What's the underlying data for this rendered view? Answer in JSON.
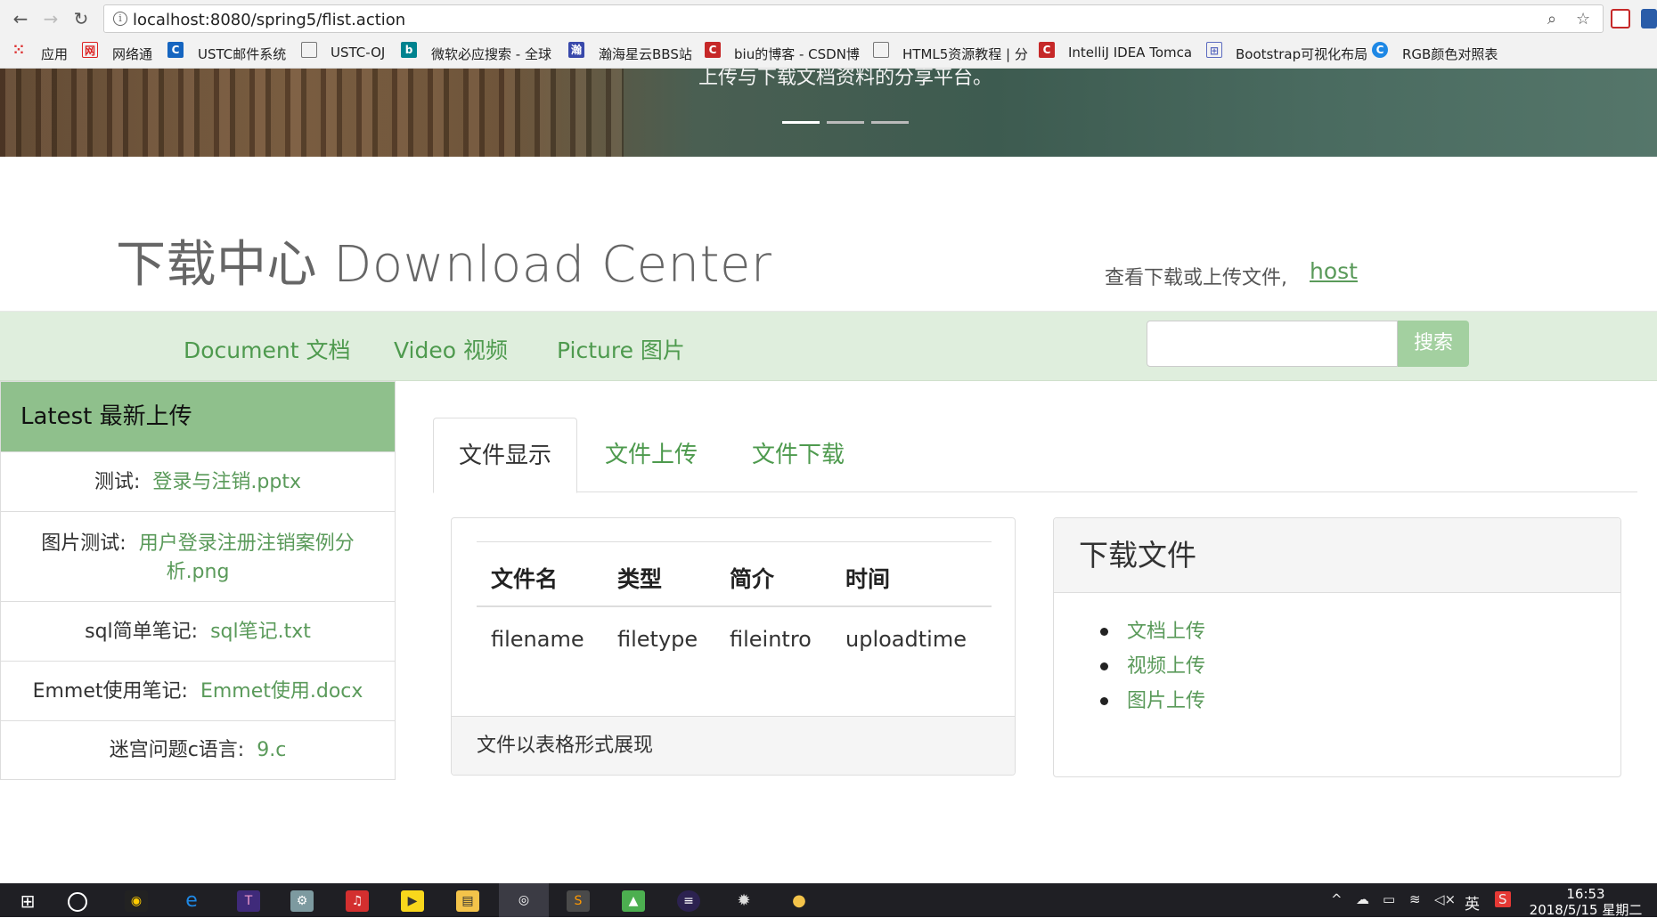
{
  "browser": {
    "url": "localhost:8080/spring5/flist.action",
    "bookmarks": [
      "应用",
      "网络通",
      "USTC邮件系统",
      "USTC-OJ",
      "微软必应搜索 - 全球",
      "瀚海星云BBS站",
      "biu的博客 - CSDN博",
      "HTML5资源教程 | 分",
      "IntelliJ IDEA Tomca",
      "Bootstrap可视化布局",
      "RGB颜色对照表"
    ]
  },
  "banner": {
    "caption": "上传与下载文档资料的分享平台。"
  },
  "header": {
    "title": "下载中心 Download Center",
    "subtitle": "查看下载或上传文件,",
    "user_link": "host"
  },
  "navbar": {
    "links": [
      "Document 文档",
      "Video 视频",
      "Picture 图片"
    ],
    "search_value": "",
    "search_button": "搜索"
  },
  "sidebar": {
    "heading": "Latest 最新上传",
    "items": [
      {
        "label": "测试:",
        "file": "登录与注销.pptx"
      },
      {
        "label": "图片测试:",
        "file": "用户登录注册注销案例分析.png"
      },
      {
        "label": "sql简单笔记:",
        "file": "sql笔记.txt"
      },
      {
        "label": "Emmet使用笔记:",
        "file": "Emmet使用.docx"
      },
      {
        "label": "迷宫问题c语言:",
        "file": "9.c"
      }
    ]
  },
  "tabs": [
    "文件显示",
    "文件上传",
    "文件下载"
  ],
  "file_table": {
    "headers": [
      "文件名",
      "类型",
      "简介",
      "时间"
    ],
    "row": [
      "filename",
      "filetype",
      "fileintro",
      "uploadtime"
    ],
    "footer": "文件以表格形式展现"
  },
  "download_panel": {
    "title": "下载文件",
    "links": [
      "文档上传",
      "视频上传",
      "图片上传"
    ]
  },
  "taskbar": {
    "time": "16:53",
    "date": "2018/5/15 星期二",
    "ime": "英"
  }
}
